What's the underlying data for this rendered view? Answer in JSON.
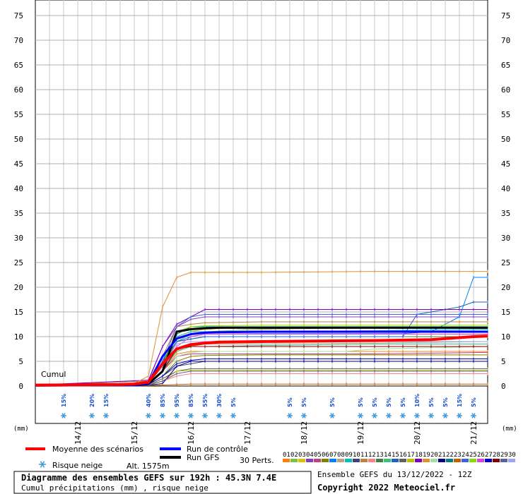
{
  "chart_data": {
    "type": "line",
    "title": "Diagramme des ensembles GEFS sur 192h : 45.3N 7.4E",
    "subtitle": "Cumul précipitations (mm) , risque neige",
    "cumul_label": "Cumul",
    "y_unit_left": "(mm)",
    "y_unit_right": "(mm)",
    "ylim": [
      0,
      75
    ],
    "yticks": [
      0,
      5,
      10,
      15,
      20,
      25,
      30,
      35,
      40,
      45,
      50,
      55,
      60,
      65,
      70,
      75
    ],
    "ytick_labels": [
      "0",
      "5",
      "10",
      "15",
      "20",
      "25",
      "30",
      "35",
      "40",
      "45",
      "50",
      "55",
      "60",
      "65",
      "70",
      "75"
    ],
    "xlim": [
      0,
      192
    ],
    "x_step_hours": 6,
    "day_labels": [
      {
        "hour": 18,
        "label": "14/12"
      },
      {
        "hour": 42,
        "label": "15/12"
      },
      {
        "hour": 66,
        "label": "16/12"
      },
      {
        "hour": 90,
        "label": "17/12"
      },
      {
        "hour": 114,
        "label": "18/12"
      },
      {
        "hour": 138,
        "label": "19/12"
      },
      {
        "hour": 162,
        "label": "20/12"
      },
      {
        "hour": 186,
        "label": "21/12"
      }
    ],
    "snow_risk": [
      {
        "hour": 12,
        "label": "15%"
      },
      {
        "hour": 24,
        "label": "20%"
      },
      {
        "hour": 30,
        "label": "15%"
      },
      {
        "hour": 48,
        "label": "40%"
      },
      {
        "hour": 54,
        "label": "85%"
      },
      {
        "hour": 60,
        "label": "95%"
      },
      {
        "hour": 66,
        "label": "85%"
      },
      {
        "hour": 72,
        "label": "55%"
      },
      {
        "hour": 78,
        "label": "30%"
      },
      {
        "hour": 84,
        "label": "5%"
      },
      {
        "hour": 108,
        "label": "5%"
      },
      {
        "hour": 114,
        "label": "5%"
      },
      {
        "hour": 126,
        "label": "5%"
      },
      {
        "hour": 138,
        "label": "5%"
      },
      {
        "hour": 144,
        "label": "5%"
      },
      {
        "hour": 150,
        "label": "5%"
      },
      {
        "hour": 156,
        "label": "5%"
      },
      {
        "hour": 162,
        "label": "10%"
      },
      {
        "hour": 168,
        "label": "5%"
      },
      {
        "hour": 174,
        "label": "5%"
      },
      {
        "hour": 180,
        "label": "15%"
      },
      {
        "hour": 186,
        "label": "5%"
      }
    ],
    "series": [
      {
        "name": "Moyenne des scénarios",
        "color": "#ff0000",
        "width": 4,
        "x": [
          0,
          36,
          42,
          48,
          54,
          60,
          66,
          72,
          78,
          96,
          120,
          144,
          168,
          180,
          186,
          192
        ],
        "y": [
          0.2,
          0.3,
          0.4,
          0.8,
          4.5,
          7.5,
          8.4,
          8.7,
          8.9,
          9.0,
          9.1,
          9.2,
          9.4,
          9.8,
          10.0,
          10.1
        ]
      },
      {
        "name": "Run de contrôle",
        "color": "#0000ff",
        "width": 3,
        "x": [
          0,
          42,
          48,
          54,
          60,
          66,
          72,
          78,
          96,
          192
        ],
        "y": [
          0.1,
          0.2,
          0.5,
          6.0,
          9.6,
          10.5,
          10.8,
          10.9,
          11.0,
          11.0
        ]
      },
      {
        "name": "Run GFS",
        "color": "#000000",
        "width": 3,
        "x": [
          0,
          42,
          48,
          54,
          60,
          66,
          72,
          78,
          96,
          192
        ],
        "y": [
          0.1,
          0.2,
          0.4,
          3.0,
          11.0,
          11.5,
          11.7,
          11.8,
          11.8,
          11.8
        ]
      },
      {
        "name": "01",
        "color": "#ff8000",
        "width": 1,
        "x": [
          0,
          48,
          54,
          60,
          66,
          72,
          96,
          144,
          192
        ],
        "y": [
          0.1,
          0.6,
          3.0,
          6.5,
          7.0,
          7.0,
          7.0,
          7.0,
          7.0
        ]
      },
      {
        "name": "02",
        "color": "#80c040",
        "width": 1,
        "x": [
          0,
          48,
          54,
          60,
          66,
          72,
          96,
          144,
          192
        ],
        "y": [
          0.1,
          0.4,
          4.0,
          9.0,
          10.5,
          11.0,
          11.5,
          11.8,
          12.0
        ]
      },
      {
        "name": "03",
        "color": "#e0c000",
        "width": 1,
        "x": [
          0,
          48,
          54,
          60,
          66,
          72,
          96,
          144,
          192
        ],
        "y": [
          0.1,
          0.5,
          5.0,
          10.0,
          11.0,
          11.5,
          12.0,
          12.0,
          12.0
        ]
      },
      {
        "name": "04",
        "color": "#8040c0",
        "width": 1,
        "x": [
          0,
          48,
          54,
          60,
          66,
          72,
          96,
          144,
          192
        ],
        "y": [
          0.2,
          1.0,
          8.0,
          12.0,
          13.5,
          14.0,
          14.0,
          14.0,
          14.0
        ]
      },
      {
        "name": "05",
        "color": "#c04080",
        "width": 1,
        "x": [
          0,
          48,
          54,
          60,
          66,
          72,
          96,
          144,
          192
        ],
        "y": [
          0.1,
          0.3,
          3.0,
          6.0,
          6.5,
          6.5,
          6.5,
          6.5,
          6.8
        ]
      },
      {
        "name": "06",
        "color": "#808000",
        "width": 1,
        "x": [
          0,
          48,
          54,
          60,
          66,
          72,
          96,
          144,
          192
        ],
        "y": [
          0.1,
          0.3,
          2.0,
          5.0,
          6.0,
          6.2,
          6.3,
          6.3,
          6.3
        ]
      },
      {
        "name": "07",
        "color": "#0080ff",
        "width": 1,
        "x": [
          0,
          48,
          54,
          60,
          66,
          72,
          96,
          132,
          156,
          168,
          180,
          186,
          192
        ],
        "y": [
          0.1,
          0.4,
          4.0,
          9.0,
          10.0,
          10.5,
          10.6,
          10.6,
          10.6,
          11.0,
          14.0,
          22.0,
          22.0
        ]
      },
      {
        "name": "08",
        "color": "#c0a080",
        "width": 1,
        "x": [
          0,
          48,
          54,
          60,
          66,
          72,
          96,
          144,
          192
        ],
        "y": [
          0.1,
          0.5,
          4.0,
          7.0,
          8.0,
          8.5,
          8.5,
          8.7,
          9.0
        ]
      },
      {
        "name": "09",
        "color": "#00c0c0",
        "width": 1,
        "x": [
          0,
          48,
          54,
          60,
          66,
          72,
          96,
          144,
          192
        ],
        "y": [
          0.1,
          0.5,
          5.0,
          10.0,
          11.0,
          11.0,
          11.0,
          11.2,
          11.5
        ]
      },
      {
        "name": "10",
        "color": "#404080",
        "width": 1,
        "x": [
          0,
          48,
          54,
          60,
          66,
          72,
          96,
          144,
          192
        ],
        "y": [
          0.1,
          0.3,
          2.0,
          4.0,
          4.5,
          5.0,
          5.0,
          5.0,
          5.0
        ]
      },
      {
        "name": "11",
        "color": "#c08040",
        "width": 1,
        "x": [
          0,
          48,
          54,
          60,
          66,
          72,
          96,
          144,
          192
        ],
        "y": [
          0.2,
          1.0,
          6.0,
          12.0,
          12.5,
          12.8,
          13.0,
          13.0,
          13.0
        ]
      },
      {
        "name": "12",
        "color": "#ff8080",
        "width": 1,
        "x": [
          0,
          48,
          54,
          60,
          66,
          72,
          96,
          144,
          192
        ],
        "y": [
          0.1,
          0.2,
          1.0,
          2.0,
          2.5,
          2.5,
          2.5,
          2.5,
          2.5
        ]
      },
      {
        "name": "13",
        "color": "#408040",
        "width": 1,
        "x": [
          0,
          48,
          54,
          60,
          66,
          72,
          96,
          144,
          192
        ],
        "y": [
          0.1,
          0.4,
          4.0,
          9.0,
          9.5,
          10.0,
          10.0,
          10.0,
          10.0
        ]
      },
      {
        "name": "14",
        "color": "#40c080",
        "width": 1,
        "x": [
          0,
          48,
          54,
          60,
          66,
          72,
          96,
          144,
          192
        ],
        "y": [
          0.1,
          0.3,
          3.0,
          7.0,
          8.0,
          8.0,
          8.2,
          8.5,
          8.5
        ]
      },
      {
        "name": "15",
        "color": "#2060c0",
        "width": 1,
        "x": [
          0,
          48,
          54,
          60,
          66,
          72,
          96,
          156,
          162,
          180,
          186,
          192
        ],
        "y": [
          0.1,
          0.5,
          5.0,
          9.0,
          9.5,
          10.0,
          10.0,
          10.0,
          14.5,
          16.0,
          17.0,
          17.0
        ]
      },
      {
        "name": "16",
        "color": "#606060",
        "width": 1,
        "x": [
          0,
          48,
          54,
          60,
          66,
          72,
          96,
          144,
          192
        ],
        "y": [
          0.1,
          0.2,
          1.5,
          3.0,
          3.5,
          3.5,
          3.5,
          3.5,
          3.5
        ]
      },
      {
        "name": "17",
        "color": "#c0c000",
        "width": 1,
        "x": [
          0,
          48,
          54,
          60,
          66,
          72,
          96,
          144,
          192
        ],
        "y": [
          0.1,
          0.3,
          1.0,
          3.0,
          3.2,
          3.2,
          3.2,
          3.2,
          3.2
        ]
      },
      {
        "name": "18",
        "color": "#8000c0",
        "width": 1,
        "x": [
          0,
          48,
          54,
          60,
          66,
          72,
          96,
          144,
          192
        ],
        "y": [
          0.2,
          1.2,
          8.0,
          12.5,
          14.0,
          15.5,
          15.5,
          15.5,
          15.5
        ]
      },
      {
        "name": "19",
        "color": "#e09030",
        "width": 1,
        "x": [
          0,
          42,
          48,
          54,
          60,
          66,
          72,
          96,
          144,
          192
        ],
        "y": [
          0.2,
          0.5,
          2.0,
          16.0,
          22.0,
          23.0,
          23.0,
          23.0,
          23.2,
          23.2
        ]
      },
      {
        "name": "20",
        "color": "#a0e0a0",
        "width": 1,
        "x": [
          0,
          48,
          54,
          60,
          66,
          72,
          96,
          132,
          144,
          192
        ],
        "y": [
          0.1,
          0.3,
          2.0,
          6.0,
          6.8,
          7.0,
          7.0,
          7.0,
          7.5,
          8.0
        ]
      },
      {
        "name": "21",
        "color": "#000080",
        "width": 1,
        "x": [
          0,
          48,
          54,
          60,
          66,
          72,
          96,
          144,
          192
        ],
        "y": [
          0.1,
          0.2,
          0.5,
          4.0,
          5.0,
          5.0,
          5.0,
          5.0,
          5.0
        ]
      },
      {
        "name": "22",
        "color": "#008080",
        "width": 1,
        "x": [
          0,
          48,
          54,
          60,
          66,
          72,
          96,
          144,
          192
        ],
        "y": [
          0.1,
          0.4,
          4.5,
          10.5,
          12.0,
          12.0,
          12.0,
          12.0,
          12.0
        ]
      },
      {
        "name": "23",
        "color": "#c06000",
        "width": 1,
        "x": [
          0,
          48,
          54,
          60,
          66,
          72,
          96,
          144,
          192
        ],
        "y": [
          0.1,
          0.1,
          0.2,
          0.3,
          0.4,
          0.4,
          0.4,
          0.4,
          0.4
        ]
      },
      {
        "name": "24",
        "color": "#4060e0",
        "width": 1,
        "x": [
          0,
          48,
          54,
          60,
          66,
          72,
          96,
          144,
          192
        ],
        "y": [
          0.1,
          0.5,
          5.0,
          12.0,
          14.0,
          14.5,
          14.5,
          14.5,
          14.5
        ]
      },
      {
        "name": "25",
        "color": "#80e000",
        "width": 1,
        "x": [
          0,
          48,
          54,
          60,
          66,
          72,
          96,
          144,
          192
        ],
        "y": [
          0.1,
          0.4,
          4.0,
          11.0,
          12.0,
          12.2,
          12.3,
          12.3,
          12.3
        ]
      },
      {
        "name": "26",
        "color": "#e040e0",
        "width": 1,
        "x": [
          0,
          48,
          54,
          60,
          66,
          72,
          96,
          144,
          192
        ],
        "y": [
          0.1,
          0.3,
          3.0,
          8.0,
          10.0,
          10.5,
          10.5,
          10.5,
          10.5
        ]
      },
      {
        "name": "27",
        "color": "#0000c0",
        "width": 1,
        "x": [
          0,
          48,
          54,
          60,
          66,
          72,
          96,
          144,
          192
        ],
        "y": [
          0.1,
          0.3,
          2.0,
          4.5,
          5.2,
          5.5,
          5.5,
          5.5,
          5.5
        ]
      },
      {
        "name": "28",
        "color": "#800000",
        "width": 1,
        "x": [
          0,
          48,
          54,
          60,
          66,
          72,
          96,
          144,
          192
        ],
        "y": [
          0.1,
          0.3,
          3.0,
          7.5,
          8.0,
          8.0,
          8.0,
          8.0,
          8.0
        ]
      },
      {
        "name": "29",
        "color": "#6060a0",
        "width": 1,
        "x": [
          0,
          48,
          54,
          60,
          66,
          72,
          96,
          144,
          192
        ],
        "y": [
          0.1,
          0.2,
          1.0,
          2.5,
          3.0,
          3.0,
          3.0,
          3.0,
          3.0
        ]
      },
      {
        "name": "30",
        "color": "#a0a0ff",
        "width": 1,
        "x": [
          0,
          48,
          54,
          60,
          66,
          72,
          96,
          144,
          192
        ],
        "y": [
          0.1,
          0.4,
          4.0,
          8.5,
          9.0,
          9.0,
          9.0,
          9.0,
          9.0
        ]
      }
    ],
    "grid": true
  },
  "legend": {
    "mean": "Moyenne des scénarios",
    "control": "Run de contrôle",
    "gfs": "Run GFS",
    "snow": "Risque neige",
    "altitude": "Alt. 1575m",
    "perts": "30 Perts.",
    "pert_numbers": [
      "01",
      "02",
      "03",
      "04",
      "05",
      "06",
      "07",
      "08",
      "09",
      "10",
      "11",
      "12",
      "13",
      "14",
      "15",
      "16",
      "17",
      "18",
      "19",
      "20",
      "21",
      "22",
      "23",
      "24",
      "25",
      "26",
      "27",
      "28",
      "29",
      "30"
    ],
    "pert_colors": [
      "#ff8000",
      "#80c040",
      "#e0c000",
      "#8040c0",
      "#c04080",
      "#808000",
      "#0080ff",
      "#c0a080",
      "#00c0c0",
      "#404080",
      "#c08040",
      "#ff8080",
      "#408040",
      "#40c080",
      "#2060c0",
      "#606060",
      "#c0c000",
      "#8000c0",
      "#e09030",
      "#a0e0a0",
      "#000080",
      "#008080",
      "#c06000",
      "#4060e0",
      "#80e000",
      "#e040e0",
      "#0000c0",
      "#800000",
      "#6060a0",
      "#a0a0ff"
    ],
    "mean_color": "#ff0000",
    "control_color": "#0000ff",
    "gfs_color": "#000000"
  },
  "footer": {
    "run_info": "Ensemble GEFS du 13/12/2022 - 12Z",
    "copyright": "Copyright 2022 Meteociel.fr"
  }
}
